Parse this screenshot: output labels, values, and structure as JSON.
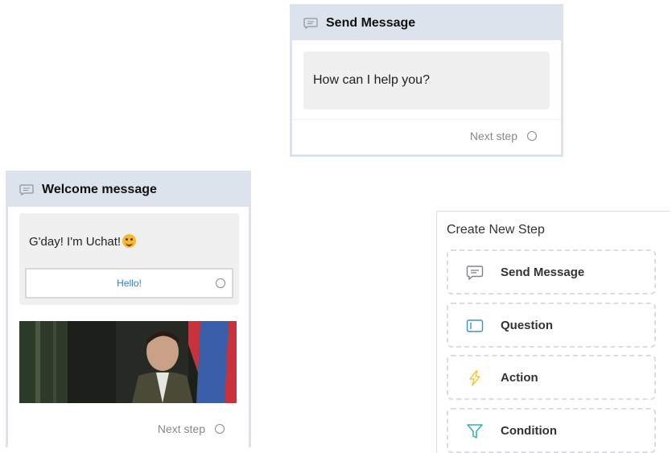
{
  "send_node": {
    "title": "Send Message",
    "message": "How can I help you?",
    "next_step": "Next step"
  },
  "welcome_node": {
    "title": "Welcome message",
    "message": "G'day! I'm Uchat!",
    "emoji": "yum-emoji-icon",
    "button_label": "Hello!",
    "next_step": "Next step"
  },
  "create_panel": {
    "title": "Create New Step",
    "options": [
      {
        "label": "Send Message",
        "icon": "message-icon"
      },
      {
        "label": "Question",
        "icon": "question-input-icon"
      },
      {
        "label": "Action",
        "icon": "lightning-icon"
      },
      {
        "label": "Condition",
        "icon": "filter-icon"
      }
    ]
  },
  "colors": {
    "header_bg": "#dde3ec",
    "bubble_bg": "#f0f0f0",
    "button_text": "#2d7fd3",
    "action_icon": "#f5c542",
    "condition_icon": "#2bb3a3",
    "question_icon": "#3a8fd9"
  }
}
